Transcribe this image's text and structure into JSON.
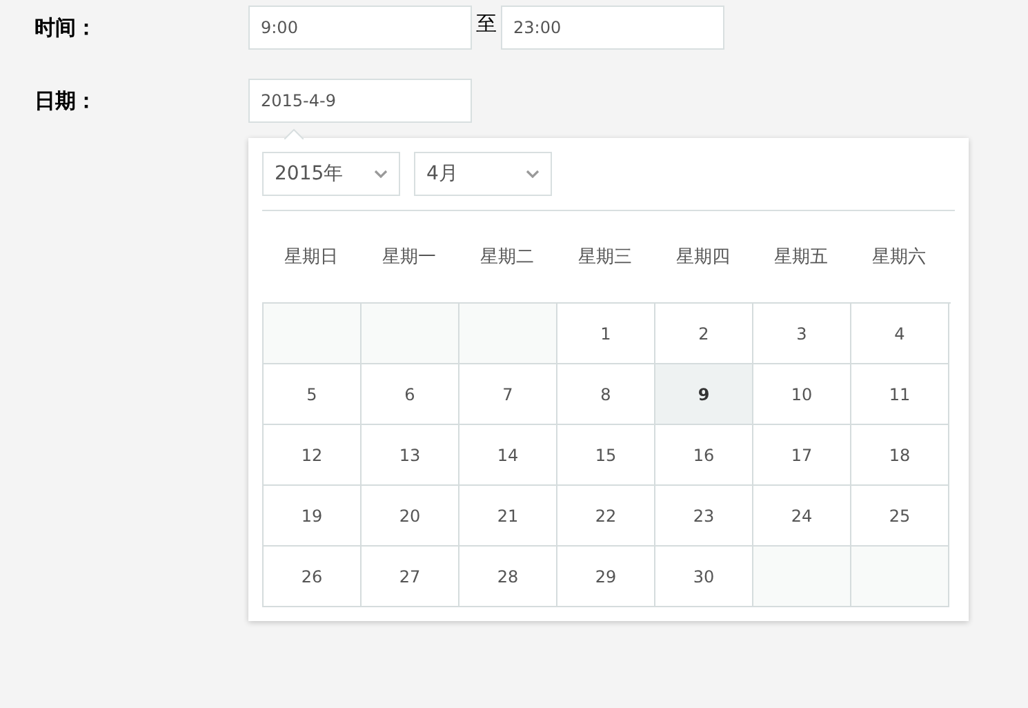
{
  "time_row": {
    "label": "时间：",
    "start": {
      "value": "9:00"
    },
    "separator": "至",
    "end": {
      "value": "23:00"
    }
  },
  "date_row": {
    "label": "日期：",
    "value": "2015-4-9"
  },
  "calendar": {
    "year": "2015年",
    "month": "4月",
    "weekdays": [
      "星期日",
      "星期一",
      "星期二",
      "星期三",
      "星期四",
      "星期五",
      "星期六"
    ],
    "cells": [
      {
        "kind": "blank"
      },
      {
        "kind": "blank"
      },
      {
        "kind": "blank"
      },
      {
        "kind": "day",
        "day": "1",
        "selected": false
      },
      {
        "kind": "day",
        "day": "2",
        "selected": false
      },
      {
        "kind": "day",
        "day": "3",
        "selected": false
      },
      {
        "kind": "day",
        "day": "4",
        "selected": false
      },
      {
        "kind": "day",
        "day": "5",
        "selected": false
      },
      {
        "kind": "day",
        "day": "6",
        "selected": false
      },
      {
        "kind": "day",
        "day": "7",
        "selected": false
      },
      {
        "kind": "day",
        "day": "8",
        "selected": false
      },
      {
        "kind": "day",
        "day": "9",
        "selected": true
      },
      {
        "kind": "day",
        "day": "10",
        "selected": false
      },
      {
        "kind": "day",
        "day": "11",
        "selected": false
      },
      {
        "kind": "day",
        "day": "12",
        "selected": false
      },
      {
        "kind": "day",
        "day": "13",
        "selected": false
      },
      {
        "kind": "day",
        "day": "14",
        "selected": false
      },
      {
        "kind": "day",
        "day": "15",
        "selected": false
      },
      {
        "kind": "day",
        "day": "16",
        "selected": false
      },
      {
        "kind": "day",
        "day": "17",
        "selected": false
      },
      {
        "kind": "day",
        "day": "18",
        "selected": false
      },
      {
        "kind": "day",
        "day": "19",
        "selected": false
      },
      {
        "kind": "day",
        "day": "20",
        "selected": false
      },
      {
        "kind": "day",
        "day": "21",
        "selected": false
      },
      {
        "kind": "day",
        "day": "22",
        "selected": false
      },
      {
        "kind": "day",
        "day": "23",
        "selected": false
      },
      {
        "kind": "day",
        "day": "24",
        "selected": false
      },
      {
        "kind": "day",
        "day": "25",
        "selected": false
      },
      {
        "kind": "day",
        "day": "26",
        "selected": false
      },
      {
        "kind": "day",
        "day": "27",
        "selected": false
      },
      {
        "kind": "day",
        "day": "28",
        "selected": false
      },
      {
        "kind": "day",
        "day": "29",
        "selected": false
      },
      {
        "kind": "day",
        "day": "30",
        "selected": false
      },
      {
        "kind": "blank"
      },
      {
        "kind": "blank"
      }
    ]
  }
}
